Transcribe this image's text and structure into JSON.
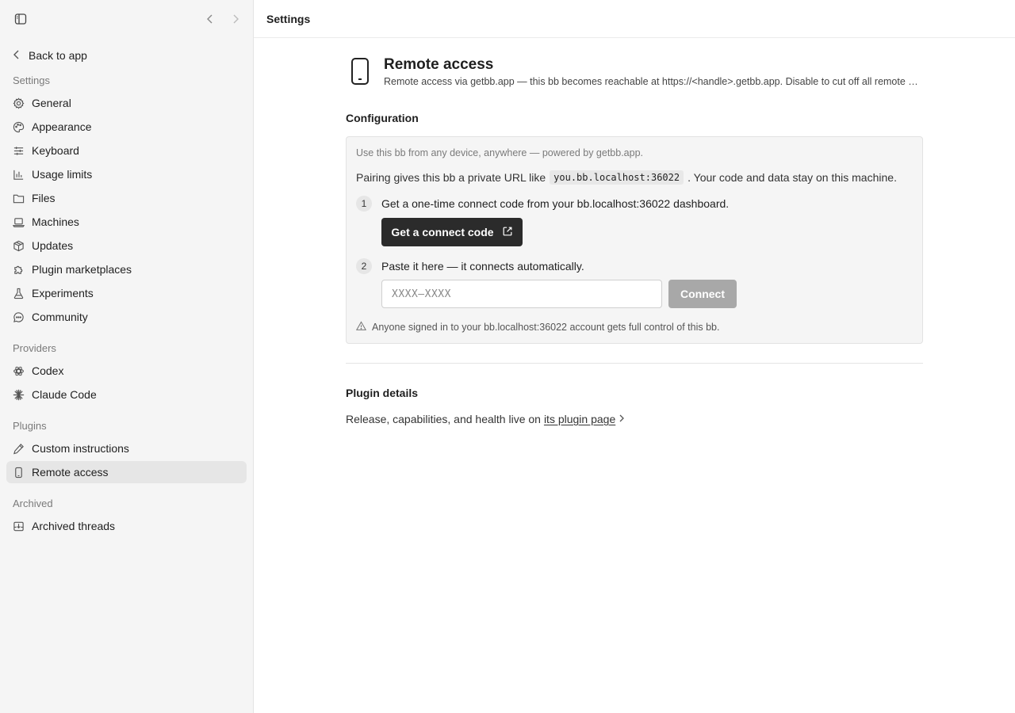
{
  "sidebar": {
    "back_label": "Back to app",
    "sections": {
      "settings": "Settings",
      "providers": "Providers",
      "plugins": "Plugins",
      "archived": "Archived"
    },
    "settings_items": [
      {
        "label": "General",
        "icon": "gear-icon"
      },
      {
        "label": "Appearance",
        "icon": "palette-icon"
      },
      {
        "label": "Keyboard",
        "icon": "sliders-icon"
      },
      {
        "label": "Usage limits",
        "icon": "bar-chart-icon"
      },
      {
        "label": "Files",
        "icon": "folder-icon"
      },
      {
        "label": "Machines",
        "icon": "laptop-icon"
      },
      {
        "label": "Updates",
        "icon": "package-icon"
      },
      {
        "label": "Plugin marketplaces",
        "icon": "puzzle-icon"
      },
      {
        "label": "Experiments",
        "icon": "flask-icon"
      },
      {
        "label": "Community",
        "icon": "chat-bubble-icon"
      }
    ],
    "provider_items": [
      {
        "label": "Codex",
        "icon": "openai-icon"
      },
      {
        "label": "Claude Code",
        "icon": "asterisk-icon"
      }
    ],
    "plugin_items": [
      {
        "label": "Custom instructions",
        "icon": "pencil-icon"
      },
      {
        "label": "Remote access",
        "icon": "phone-icon",
        "active": true
      }
    ],
    "archived_items": [
      {
        "label": "Archived threads",
        "icon": "archive-icon"
      }
    ]
  },
  "topbar": {
    "title": "Settings"
  },
  "header": {
    "title": "Remote access",
    "subtitle": "Remote access via getbb.app — this bb becomes reachable at https://<handle>.getbb.app. Disable to cut off all remote …"
  },
  "config": {
    "title": "Configuration",
    "intro": "Use this bb from any device, anywhere — powered by getbb.app.",
    "pair_before": "Pairing gives this bb a private URL like",
    "pair_code": "you.bb.localhost:36022",
    "pair_after": ". Your code and data stay on this machine.",
    "step1_num": "1",
    "step1_text": "Get a one-time connect code from your bb.localhost:36022 dashboard.",
    "get_code_label": "Get a connect code",
    "step2_num": "2",
    "step2_text": "Paste it here — it connects automatically.",
    "code_placeholder": "XXXX–XXXX",
    "connect_label": "Connect",
    "warning": "Anyone signed in to your bb.localhost:36022 account gets full control of this bb."
  },
  "plugin_details": {
    "title": "Plugin details",
    "text": "Release, capabilities, and health live on",
    "link": "its plugin page"
  },
  "colors": {
    "sidebar_bg": "#f5f5f5",
    "active_item_bg": "#e6e6e6",
    "primary_button": "#2b2b2b",
    "disabled_button": "#a8a8a8"
  }
}
